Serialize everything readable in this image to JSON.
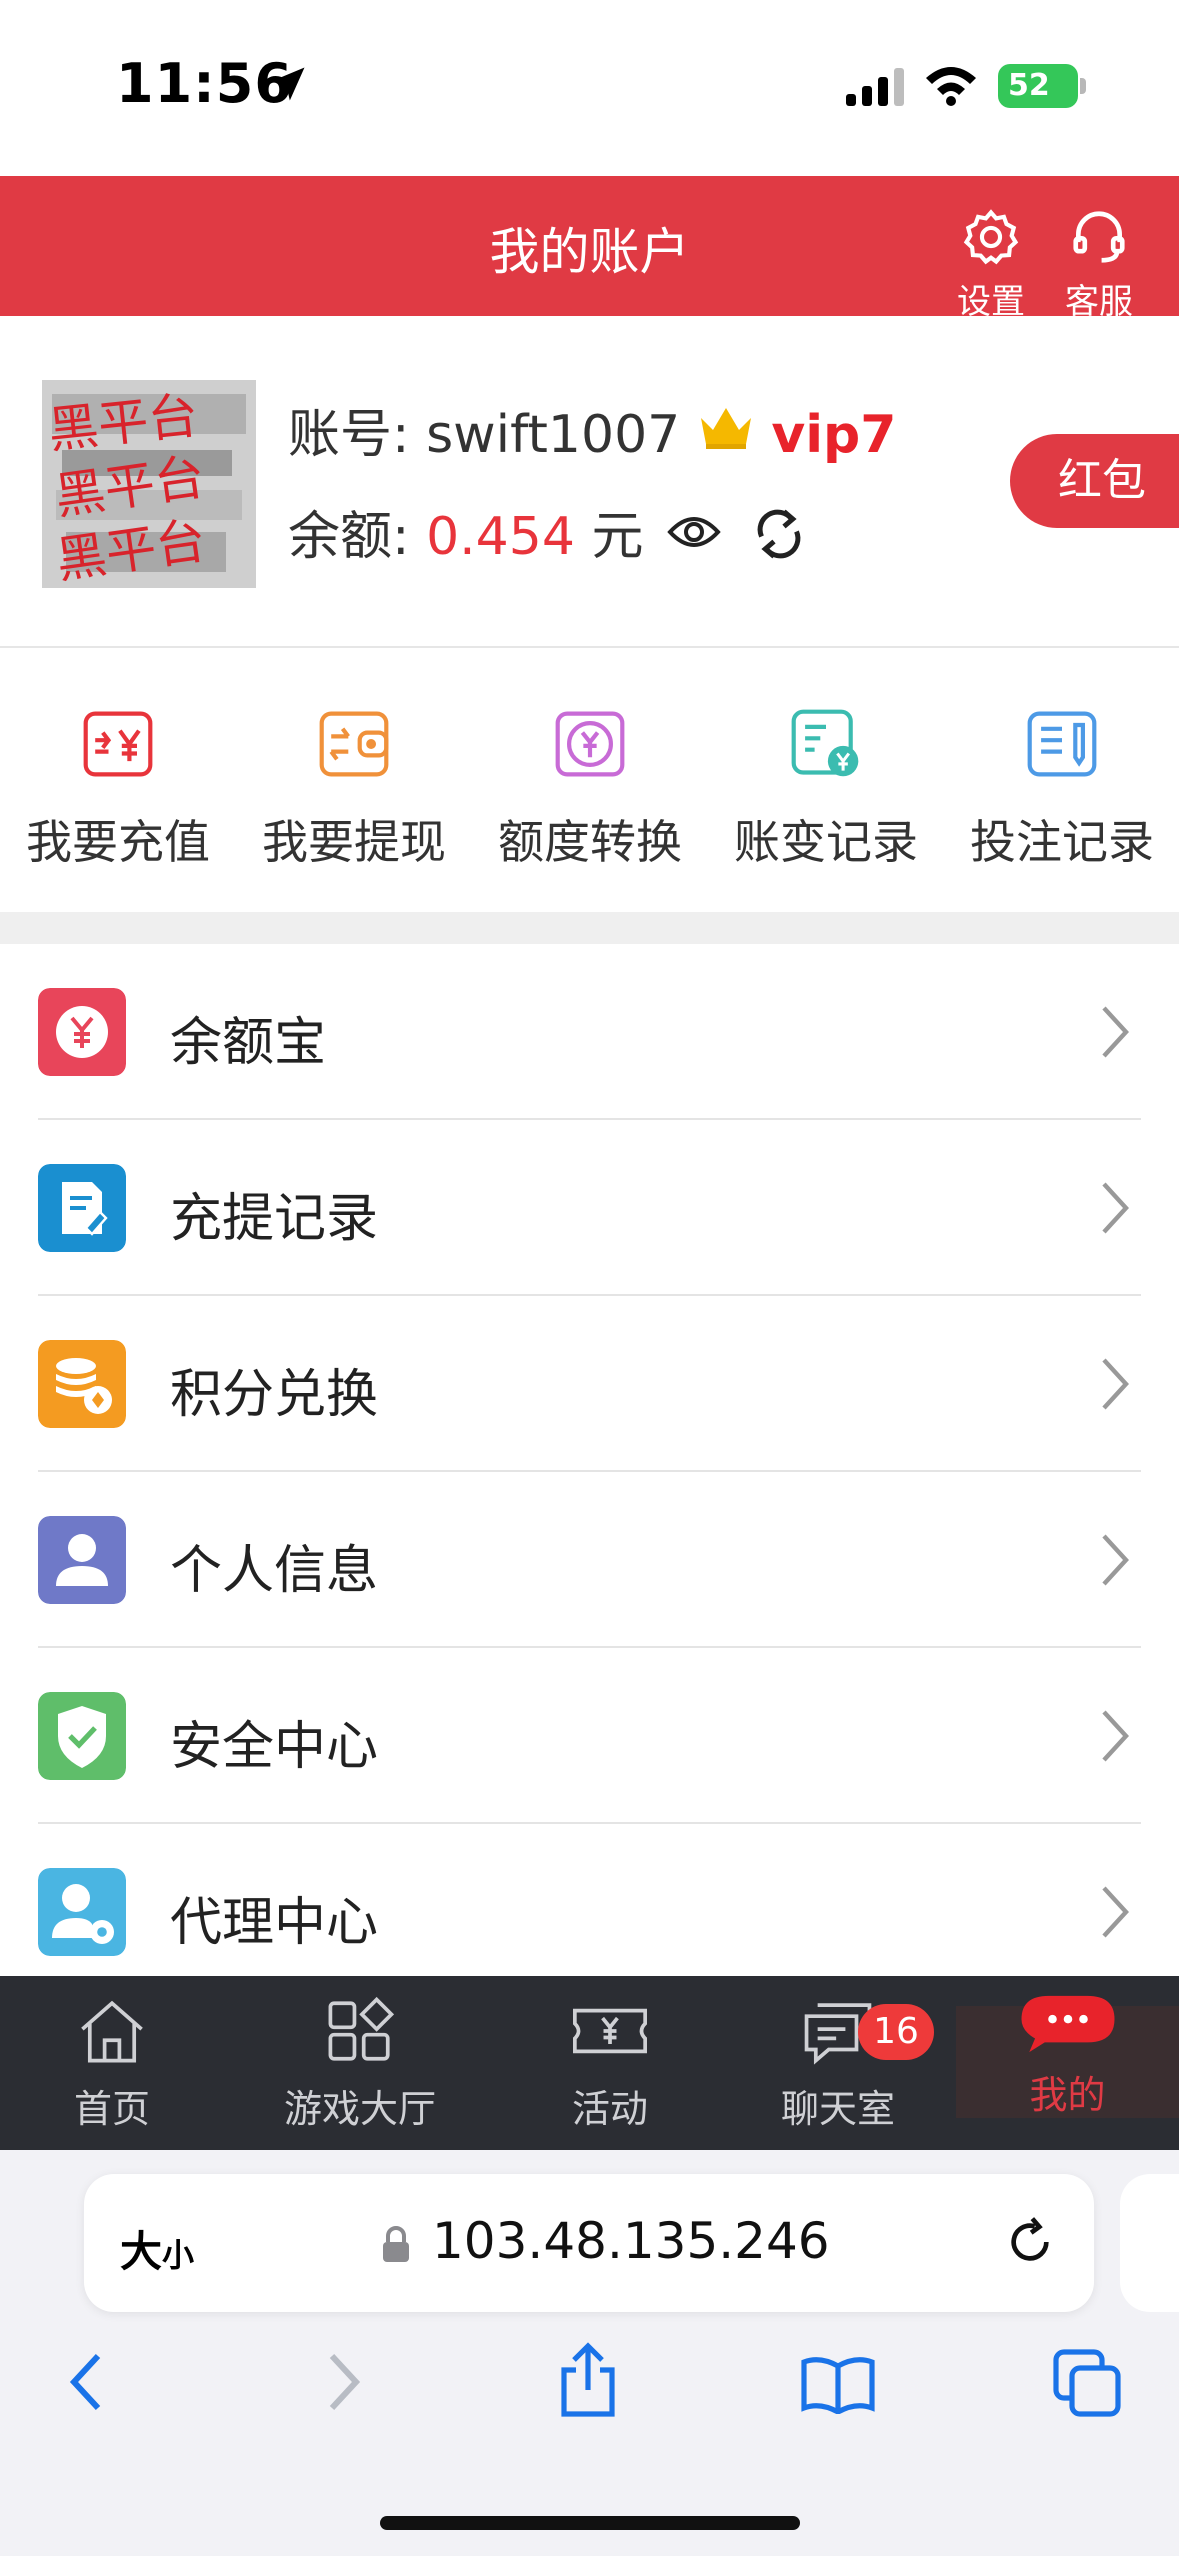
{
  "status_bar": {
    "time": "11:56",
    "battery": "52"
  },
  "header": {
    "title": "我的账户",
    "settings_label": "设置",
    "service_label": "客服"
  },
  "account": {
    "account_label": "账号:",
    "username": "swift1007",
    "vip": "vip7",
    "balance_label": "余额:",
    "balance": "0.454",
    "currency": "元",
    "red_packet": "红包",
    "avatar_stamp": "黑平台"
  },
  "quick_actions": [
    {
      "label": "我要充值",
      "icon": "deposit-icon",
      "color": "#e8343b"
    },
    {
      "label": "我要提现",
      "icon": "withdraw-icon",
      "color": "#f0913a"
    },
    {
      "label": "额度转换",
      "icon": "transfer-icon",
      "color": "#c86bd6"
    },
    {
      "label": "账变记录",
      "icon": "account-change-icon",
      "color": "#3bbcb0"
    },
    {
      "label": "投注记录",
      "icon": "bet-record-icon",
      "color": "#4d9ae6"
    }
  ],
  "menu": [
    {
      "label": "余额宝",
      "icon": "yuan-icon",
      "color": "#e8455a"
    },
    {
      "label": "充提记录",
      "icon": "record-icon",
      "color": "#1a8fd0"
    },
    {
      "label": "积分兑换",
      "icon": "points-icon",
      "color": "#f49b21"
    },
    {
      "label": "个人信息",
      "icon": "person-icon",
      "color": "#6f79c8"
    },
    {
      "label": "安全中心",
      "icon": "shield-icon",
      "color": "#5fbe6a"
    },
    {
      "label": "代理中心",
      "icon": "agent-icon",
      "color": "#4ab5e2"
    }
  ],
  "tabbar": [
    {
      "label": "首页",
      "icon": "home-icon"
    },
    {
      "label": "游戏大厅",
      "icon": "game-hall-icon"
    },
    {
      "label": "活动",
      "icon": "ticket-icon"
    },
    {
      "label": "聊天室",
      "icon": "chat-icon",
      "badge": "16"
    },
    {
      "label": "我的",
      "icon": "profile-chat-icon",
      "active": true
    }
  ],
  "safari": {
    "text_size": "大",
    "text_size_small": "小",
    "url": "103.48.135.246"
  }
}
